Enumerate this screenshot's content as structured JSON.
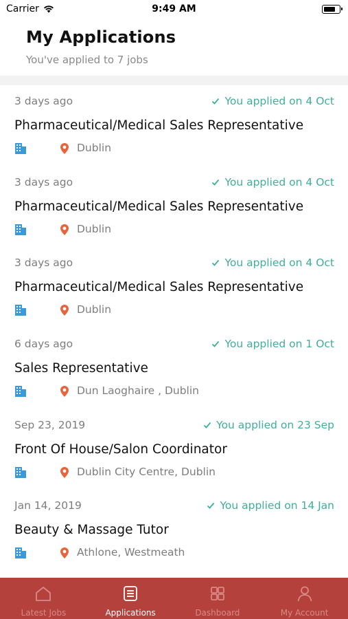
{
  "status_bar": {
    "carrier": "Carrier",
    "time": "9:49 AM"
  },
  "header": {
    "title": "My Applications",
    "subtitle": "You've applied to 7 jobs"
  },
  "applications": [
    {
      "posted": "3 days ago",
      "applied": "You applied on 4 Oct",
      "title": "Pharmaceutical/Medical Sales Representative",
      "location": "Dublin"
    },
    {
      "posted": "3 days ago",
      "applied": "You applied on 4 Oct",
      "title": "Pharmaceutical/Medical Sales Representative",
      "location": "Dublin"
    },
    {
      "posted": "3 days ago",
      "applied": "You applied on 4 Oct",
      "title": "Pharmaceutical/Medical Sales Representative",
      "location": "Dublin"
    },
    {
      "posted": "6 days ago",
      "applied": "You applied on 1 Oct",
      "title": "Sales Representative",
      "location": "Dun Laoghaire , Dublin"
    },
    {
      "posted": "Sep 23, 2019",
      "applied": "You applied on 23 Sep",
      "title": "Front Of House/Salon Coordinator",
      "location": "Dublin City Centre, Dublin"
    },
    {
      "posted": "Jan 14, 2019",
      "applied": "You applied on 14 Jan",
      "title": "Beauty & Massage Tutor",
      "location": "Athlone, Westmeath"
    }
  ],
  "tabbar": {
    "tabs": [
      {
        "label": "Latest Jobs",
        "icon": "home-icon",
        "active": false
      },
      {
        "label": "Applications",
        "icon": "document-icon",
        "active": true
      },
      {
        "label": "Dashboard",
        "icon": "grid-icon",
        "active": false
      },
      {
        "label": "My Account",
        "icon": "user-icon",
        "active": false
      }
    ]
  },
  "colors": {
    "accent_green": "#3fae9c",
    "tabbar_bg": "#b5413d",
    "building_icon": "#3a9ad9",
    "pin_icon": "#e8643c"
  }
}
